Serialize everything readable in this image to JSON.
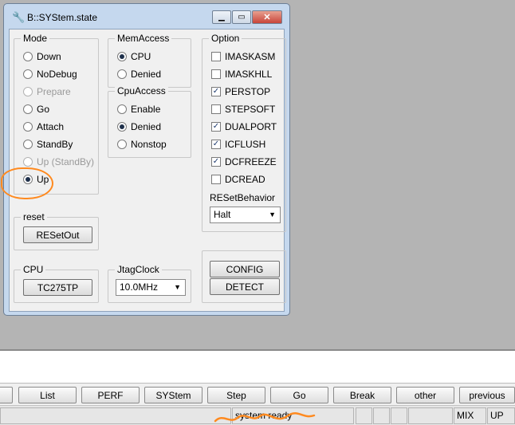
{
  "window": {
    "title": "B::SYStem.state",
    "title_icon": "wrench-icon",
    "controls": {
      "minimize": "▁",
      "maximize": "▭",
      "close": "✕"
    }
  },
  "mode": {
    "title": "Mode",
    "options": [
      {
        "label": "Down",
        "checked": false,
        "disabled": false
      },
      {
        "label": "NoDebug",
        "checked": false,
        "disabled": false
      },
      {
        "label": "Prepare",
        "checked": false,
        "disabled": true
      },
      {
        "label": "Go",
        "checked": false,
        "disabled": false
      },
      {
        "label": "Attach",
        "checked": false,
        "disabled": false
      },
      {
        "label": "StandBy",
        "checked": false,
        "disabled": false
      },
      {
        "label": "Up (StandBy)",
        "checked": false,
        "disabled": true
      },
      {
        "label": "Up",
        "checked": true,
        "disabled": false
      }
    ]
  },
  "memaccess": {
    "title": "MemAccess",
    "options": [
      {
        "label": "CPU",
        "checked": true
      },
      {
        "label": "Denied",
        "checked": false
      }
    ]
  },
  "cpuaccess": {
    "title": "CpuAccess",
    "options": [
      {
        "label": "Enable",
        "checked": false
      },
      {
        "label": "Denied",
        "checked": true
      },
      {
        "label": "Nonstop",
        "checked": false
      }
    ]
  },
  "option": {
    "title": "Option",
    "items": [
      {
        "label": "IMASKASM",
        "checked": false
      },
      {
        "label": "IMASKHLL",
        "checked": false
      },
      {
        "label": "PERSTOP",
        "checked": true
      },
      {
        "label": "STEPSOFT",
        "checked": false
      },
      {
        "label": "DUALPORT",
        "checked": true
      },
      {
        "label": "ICFLUSH",
        "checked": true
      },
      {
        "label": "DCFREEZE",
        "checked": true
      },
      {
        "label": "DCREAD",
        "checked": false
      }
    ]
  },
  "resetbehavior": {
    "title": "RESetBehavior",
    "value": "Halt"
  },
  "reset": {
    "title": "reset",
    "button": "RESetOut"
  },
  "cpu": {
    "title": "CPU",
    "button": "TC275TP"
  },
  "jtag": {
    "title": "JtagClock",
    "value": "10.0MHz"
  },
  "buttons": {
    "config": "CONFIG",
    "detect": "DETECT"
  },
  "toolbar": [
    "List",
    "PERF",
    "SYStem",
    "Step",
    "Go",
    "Break",
    "other",
    "previous"
  ],
  "status": {
    "message": "system ready",
    "mode": "MIX",
    "state": "UP"
  },
  "colors": {
    "highlight": "#ff8a1f",
    "window_frame": "#c5d8ee"
  }
}
